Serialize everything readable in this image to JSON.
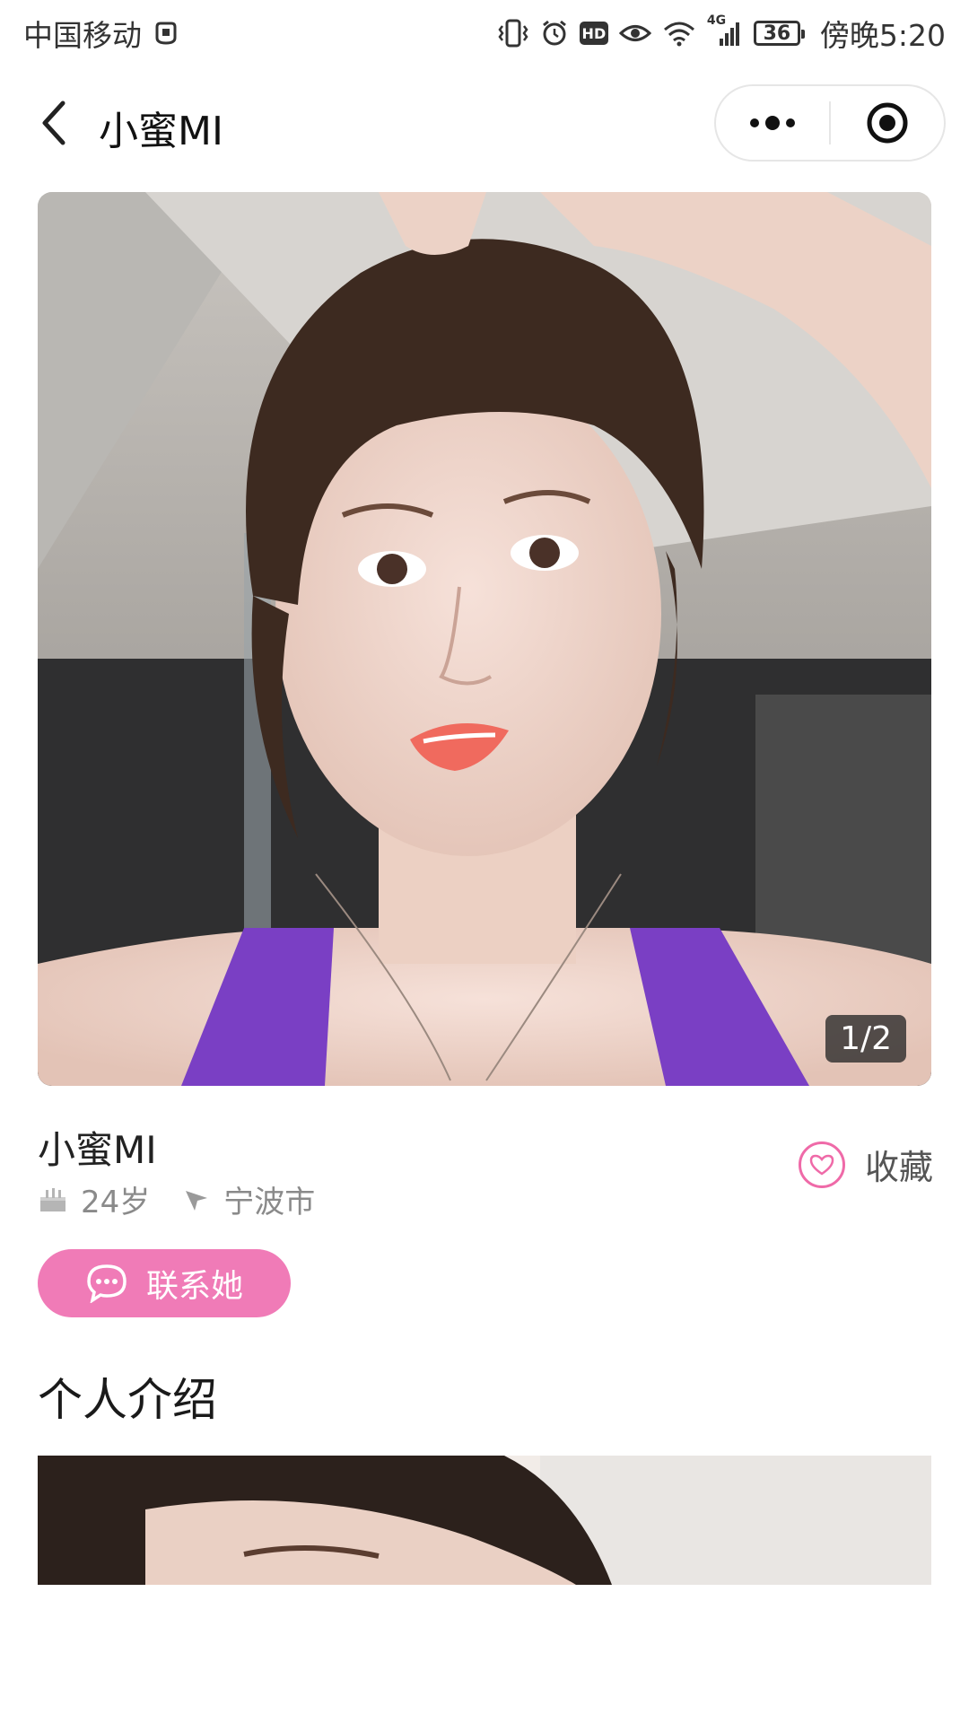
{
  "status_bar": {
    "carrier": "中国移动",
    "network": "4G",
    "battery": "36",
    "time": "傍晚5:20"
  },
  "nav": {
    "title": "小蜜MI"
  },
  "photo": {
    "counter": "1/2"
  },
  "profile": {
    "name": "小蜜MI",
    "age": "24岁",
    "city": "宁波市",
    "favorite_label": "收藏",
    "contact_label": "联系她"
  },
  "section": {
    "title": "个人介绍"
  },
  "colors": {
    "accent_pink": "#f07bb7",
    "heart_pink": "#ef6aa8"
  }
}
